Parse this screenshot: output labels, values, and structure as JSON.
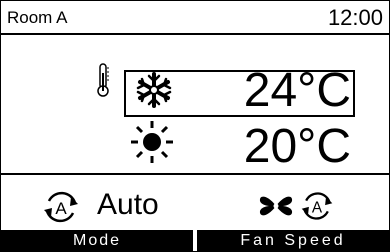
{
  "header": {
    "room": "Room A",
    "time": "12:00"
  },
  "cooling": {
    "temperature": "24°C",
    "icon": "snowflake-icon"
  },
  "heating": {
    "temperature": "20°C",
    "icon": "sun-icon"
  },
  "mode": {
    "label": "Auto",
    "icon": "auto-mode-icon"
  },
  "fan": {
    "icon": "fan-icon",
    "auto_icon": "auto-mode-icon"
  },
  "softkeys": {
    "left": "Mode",
    "right": "Fan Speed"
  }
}
